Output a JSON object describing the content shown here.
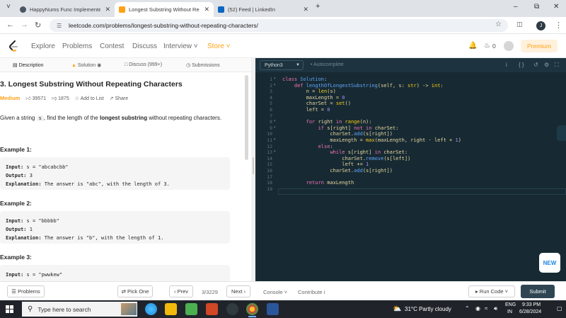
{
  "browser": {
    "tabs": [
      {
        "title": "HappyNums Func Implemented",
        "favicon_color": "#4b5563"
      },
      {
        "title": "Longest Substring Without Rep",
        "favicon_color": "#ffa116"
      },
      {
        "title": "(52) Feed | LinkedIn",
        "favicon_color": "#0a66c2"
      }
    ],
    "new_tab": "+",
    "url": "leetcode.com/problems/longest-substring-without-repeating-characters/",
    "profile_initial": "J"
  },
  "nav": {
    "links": [
      "Explore",
      "Problems",
      "Contest",
      "Discuss",
      "Interview ˅",
      "Store ˅"
    ],
    "coins": "0",
    "premium": "Premium"
  },
  "left_tabs": [
    "Description",
    "Solution",
    "Discuss (999+)",
    "Submissions"
  ],
  "problem": {
    "title": "3. Longest Substring Without Repeating Characters",
    "difficulty": "Medium",
    "likes": "39571",
    "dislikes": "1875",
    "add_to_list": "Add to List",
    "share": "Share",
    "desc_pre": "Given a string ",
    "desc_code": "s",
    "desc_mid": ", find the length of the ",
    "desc_bold": "longest substring",
    "desc_post": " without repeating characters.",
    "examples": [
      {
        "heading": "Example 1:",
        "input_label": "Input:",
        "input": " s = \"abcabcbb\"",
        "output_label": "Output:",
        "output": " 3",
        "expl_label": "Explanation:",
        "expl": " The answer is \"abc\", with the length of 3."
      },
      {
        "heading": "Example 2:",
        "input_label": "Input:",
        "input": " s = \"bbbbb\"",
        "output_label": "Output:",
        "output": " 1",
        "expl_label": "Explanation:",
        "expl": " The answer is \"b\", with the length of 1."
      },
      {
        "heading": "Example 3:",
        "input_label": "Input:",
        "input": " s = \"pwwkew\"",
        "output_label": "",
        "output": "",
        "expl_label": "",
        "expl": ""
      }
    ]
  },
  "editor": {
    "language": "Python3",
    "autocomplete": "Autocomplete",
    "new_badge": "NEW",
    "lines": [
      [
        [
          "k",
          "class "
        ],
        [
          "f",
          "Solution"
        ],
        [
          "p",
          ":"
        ]
      ],
      [
        [
          "p",
          "    "
        ],
        [
          "k",
          "def "
        ],
        [
          "f",
          "lengthOfLongestSubstring"
        ],
        [
          "p",
          "(self, s: "
        ],
        [
          "b",
          "str"
        ],
        [
          "p",
          ") -> "
        ],
        [
          "b",
          "int"
        ],
        [
          "p",
          ":"
        ]
      ],
      [
        [
          "p",
          "        n = "
        ],
        [
          "b",
          "len"
        ],
        [
          "p",
          "(s)"
        ]
      ],
      [
        [
          "p",
          "        maxLength = "
        ],
        [
          "n",
          "0"
        ]
      ],
      [
        [
          "p",
          "        charSet = "
        ],
        [
          "b",
          "set"
        ],
        [
          "p",
          "()"
        ]
      ],
      [
        [
          "p",
          "        left = "
        ],
        [
          "n",
          "0"
        ]
      ],
      [
        [
          "p",
          ""
        ]
      ],
      [
        [
          "p",
          "        "
        ],
        [
          "k",
          "for "
        ],
        [
          "p",
          "right "
        ],
        [
          "k",
          "in "
        ],
        [
          "b",
          "range"
        ],
        [
          "p",
          "(n):"
        ]
      ],
      [
        [
          "p",
          "            "
        ],
        [
          "k",
          "if "
        ],
        [
          "p",
          "s[right] "
        ],
        [
          "k",
          "not in "
        ],
        [
          "p",
          "charSet:"
        ]
      ],
      [
        [
          "p",
          "                charSet."
        ],
        [
          "f",
          "add"
        ],
        [
          "p",
          "(s[right])"
        ]
      ],
      [
        [
          "p",
          "                maxLength = "
        ],
        [
          "b",
          "max"
        ],
        [
          "p",
          "(maxLength, right - left + "
        ],
        [
          "n",
          "1"
        ],
        [
          "p",
          ")"
        ]
      ],
      [
        [
          "p",
          "            "
        ],
        [
          "k",
          "else"
        ],
        [
          "p",
          ":"
        ]
      ],
      [
        [
          "p",
          "                "
        ],
        [
          "k",
          "while "
        ],
        [
          "p",
          "s[right] "
        ],
        [
          "k",
          "in "
        ],
        [
          "p",
          "charSet:"
        ]
      ],
      [
        [
          "p",
          "                    charSet."
        ],
        [
          "f",
          "remove"
        ],
        [
          "p",
          "(s[left])"
        ]
      ],
      [
        [
          "p",
          "                    left += "
        ],
        [
          "n",
          "1"
        ]
      ],
      [
        [
          "p",
          "                charSet."
        ],
        [
          "f",
          "add"
        ],
        [
          "p",
          "(s[right])"
        ]
      ],
      [
        [
          "p",
          ""
        ]
      ],
      [
        [
          "p",
          "        "
        ],
        [
          "k",
          "return "
        ],
        [
          "p",
          "maxLength"
        ]
      ],
      [
        [
          "p",
          ""
        ]
      ]
    ],
    "folds": [
      1,
      2,
      8,
      9,
      11,
      13
    ]
  },
  "bottom": {
    "problems": "Problems",
    "pick_one": "Pick One",
    "prev": "Prev",
    "counter": "3/3229",
    "next": "Next",
    "console": "Console",
    "contribute": "Contribute",
    "run_code": "Run Code",
    "submit": "Submit"
  },
  "taskbar": {
    "search_placeholder": "Type here to search",
    "weather": "31°C  Partly cloudy",
    "lang_top": "ENG",
    "lang_bottom": "IN",
    "time": "9:33 PM",
    "date": "6/28/2024"
  }
}
